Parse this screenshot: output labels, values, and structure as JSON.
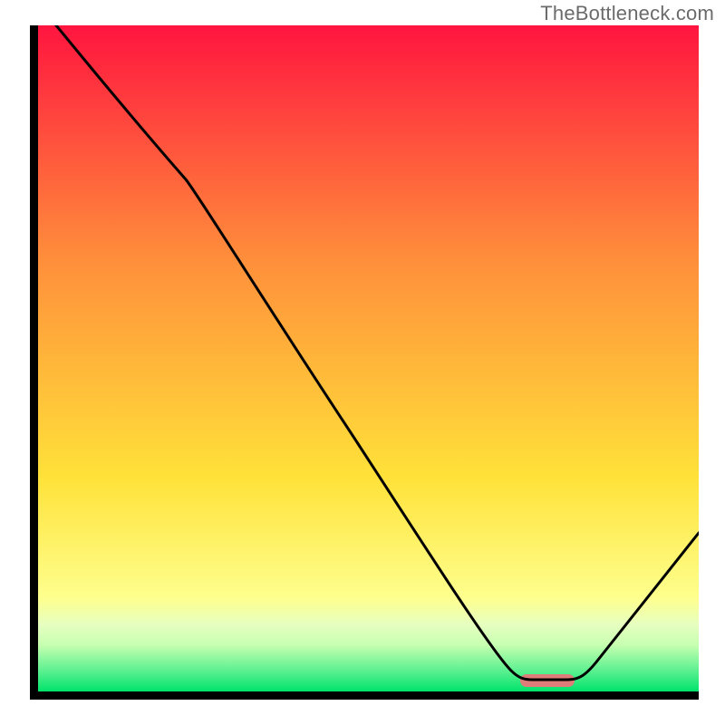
{
  "watermark": "TheBottleneck.com",
  "colors": {
    "gradient_top": "#ff153f",
    "gradient_mid_upper": "#ff8e3b",
    "gradient_mid": "#ffe239",
    "gradient_lower": "#feff8e",
    "gradient_green_light": "#c7ffb0",
    "gradient_green": "#00e36a",
    "pill": "#dd7c79",
    "axis": "#000000",
    "curve": "#000000"
  },
  "chart_data": {
    "type": "line",
    "title": "",
    "xlabel": "",
    "ylabel": "",
    "xlim": [
      0,
      100
    ],
    "ylim": [
      0,
      100
    ],
    "x": [
      0,
      3,
      22,
      72,
      78,
      80,
      100
    ],
    "values": [
      105,
      100,
      78,
      3,
      0,
      0,
      24
    ],
    "marker": {
      "x_start": 73,
      "x_end": 81,
      "y": 1.5
    },
    "gradient_stops": [
      {
        "pct": 0,
        "color": "#ff153f"
      },
      {
        "pct": 35,
        "color": "#ff8e3b"
      },
      {
        "pct": 68,
        "color": "#ffe239"
      },
      {
        "pct": 86,
        "color": "#feff8e"
      },
      {
        "pct": 93,
        "color": "#c7ffb0"
      },
      {
        "pct": 100,
        "color": "#00e36a"
      }
    ]
  }
}
